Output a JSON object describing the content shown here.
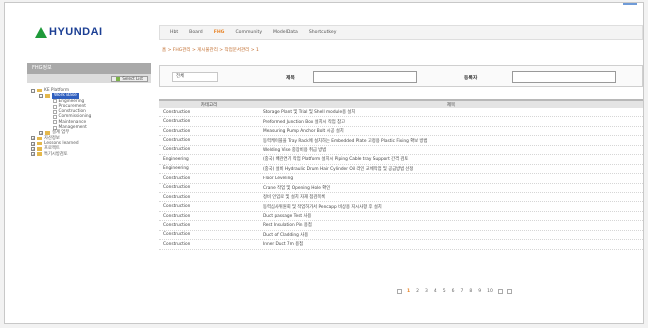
{
  "brand": {
    "logo_text": "HYUNDAI",
    "logo_color": "#1c3f94",
    "accent": "#1f9a3a"
  },
  "topnav": {
    "items": [
      {
        "label": "Hbt"
      },
      {
        "label": "Board"
      },
      {
        "label": "FHG"
      },
      {
        "label": "Community"
      },
      {
        "label": "ModelData"
      },
      {
        "label": "Shortcutkey"
      }
    ],
    "active_index": 2
  },
  "breadcrumb": "홈 > FHG관리 > 게시물관리 > 작업문서관리 > 1",
  "sidebar": {
    "header": "FHG정보",
    "button_label": "Select List",
    "tree": [
      {
        "label": "KE Platform",
        "level": 0,
        "type": "folder",
        "toggle": "-"
      },
      {
        "label": "Work Base",
        "level": 1,
        "type": "folder",
        "toggle": "-",
        "selected": true
      },
      {
        "label": "Engineering",
        "level": 2,
        "type": "doc"
      },
      {
        "label": "Procurement",
        "level": 2,
        "type": "doc"
      },
      {
        "label": "Construction",
        "level": 2,
        "type": "doc"
      },
      {
        "label": "Commissioning",
        "level": 2,
        "type": "doc"
      },
      {
        "label": "Maintenance",
        "level": 2,
        "type": "doc"
      },
      {
        "label": "Management",
        "level": 2,
        "type": "doc"
      },
      {
        "label": "설계 업무",
        "level": 1,
        "type": "folder",
        "toggle": "+"
      },
      {
        "label": "자산정보",
        "level": 0,
        "type": "folder",
        "toggle": "+"
      },
      {
        "label": "Lessons learned",
        "level": 0,
        "type": "folder",
        "toggle": "+"
      },
      {
        "label": "프로젝트",
        "level": 0,
        "type": "folder",
        "toggle": "+"
      },
      {
        "label": "특기시방검토",
        "level": 0,
        "type": "folder",
        "toggle": "+"
      }
    ]
  },
  "search": {
    "select_value": "전체",
    "label1": "제목",
    "input1_value": "",
    "label2": "등록자",
    "input2_value": ""
  },
  "table": {
    "headers": {
      "category": "카테고리",
      "title": "제목"
    },
    "rows": [
      {
        "category": "Construction",
        "title": "Storage Plant 및 Trial 및 Shell module용 설치"
      },
      {
        "category": "Construction",
        "title": "Preformed Junction Box 설치시 작업 참고"
      },
      {
        "category": "Construction",
        "title": "Measuring Pump Anchor Bolt 시공 설치"
      },
      {
        "category": "Construction",
        "title": "동력케이블을 Tray Rack에 설치하는 Embedded Plate 고정용 Plastic Fixing 확보 방법"
      },
      {
        "category": "Construction",
        "title": "Welding Vise 중장비용 취급 방법"
      },
      {
        "category": "Engineering",
        "title": "(중국) 배관연기 작업 Platform 설치시 Piping Cable tray Support 간격 검토"
      },
      {
        "category": "Engineering",
        "title": "(중국) 설비 Hydraulic Drum Hair Cylinder Oil 라인 교체작업 및 공급방법 선정"
      },
      {
        "category": "Construction",
        "title": "Floor Leveling"
      },
      {
        "category": "Construction",
        "title": "Crane 작업 및 Opening Hole 확인"
      },
      {
        "category": "Construction",
        "title": "정비 인입로 및 설치 자재 점검목록"
      },
      {
        "category": "Construction",
        "title": "동력심사위원회 및 작업허가서 Pencapp 비상용 지시사항 후 설치"
      },
      {
        "category": "Construction",
        "title": "Duct passage Test 사용"
      },
      {
        "category": "Construction",
        "title": "Rest Insulation Pin 용접"
      },
      {
        "category": "Construction",
        "title": "Duct of Cladding 사용"
      },
      {
        "category": "Construction",
        "title": "Inner Duct 7m 용접"
      }
    ]
  },
  "pagination": {
    "pages": [
      "1",
      "2",
      "3",
      "4",
      "5",
      "6",
      "7",
      "8",
      "9",
      "10"
    ],
    "current_index": 0
  },
  "colors": {
    "active_nav": "#e8862b",
    "selected_tree": "#2f5fbf",
    "breadcrumb": "#c06a2a"
  }
}
